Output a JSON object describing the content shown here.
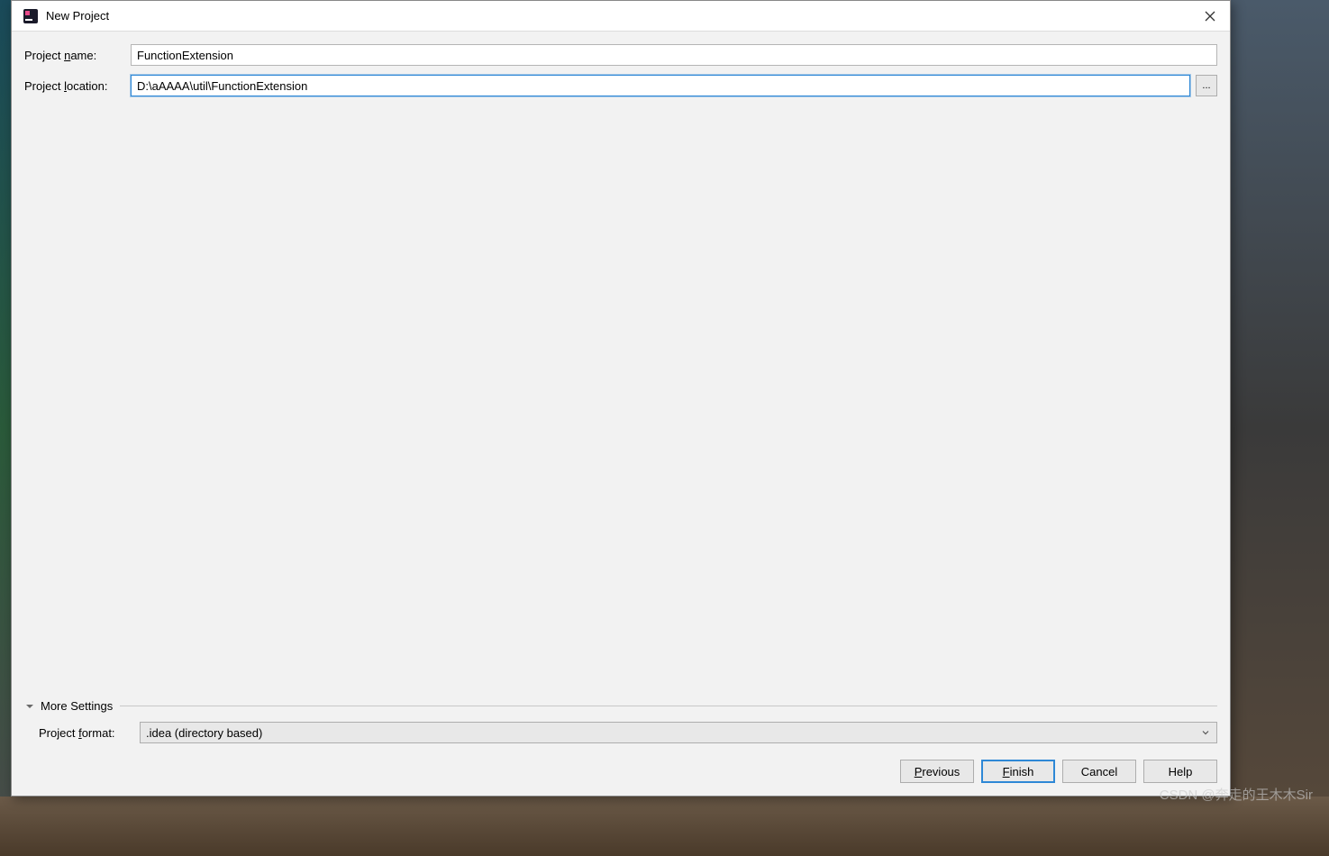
{
  "window": {
    "title": "New Project"
  },
  "form": {
    "project_name_label": "Project name:",
    "project_name_value": "FunctionExtension",
    "project_location_label": "Project location:",
    "project_location_value": "D:\\aAAAA\\util\\FunctionExtension",
    "browse_label": "..."
  },
  "more_settings": {
    "header": "More Settings",
    "format_label": "Project format:",
    "format_value": ".idea (directory based)"
  },
  "buttons": {
    "previous": "Previous",
    "finish": "Finish",
    "cancel": "Cancel",
    "help": "Help"
  },
  "watermark": "CSDN @奔走的王木木Sir"
}
